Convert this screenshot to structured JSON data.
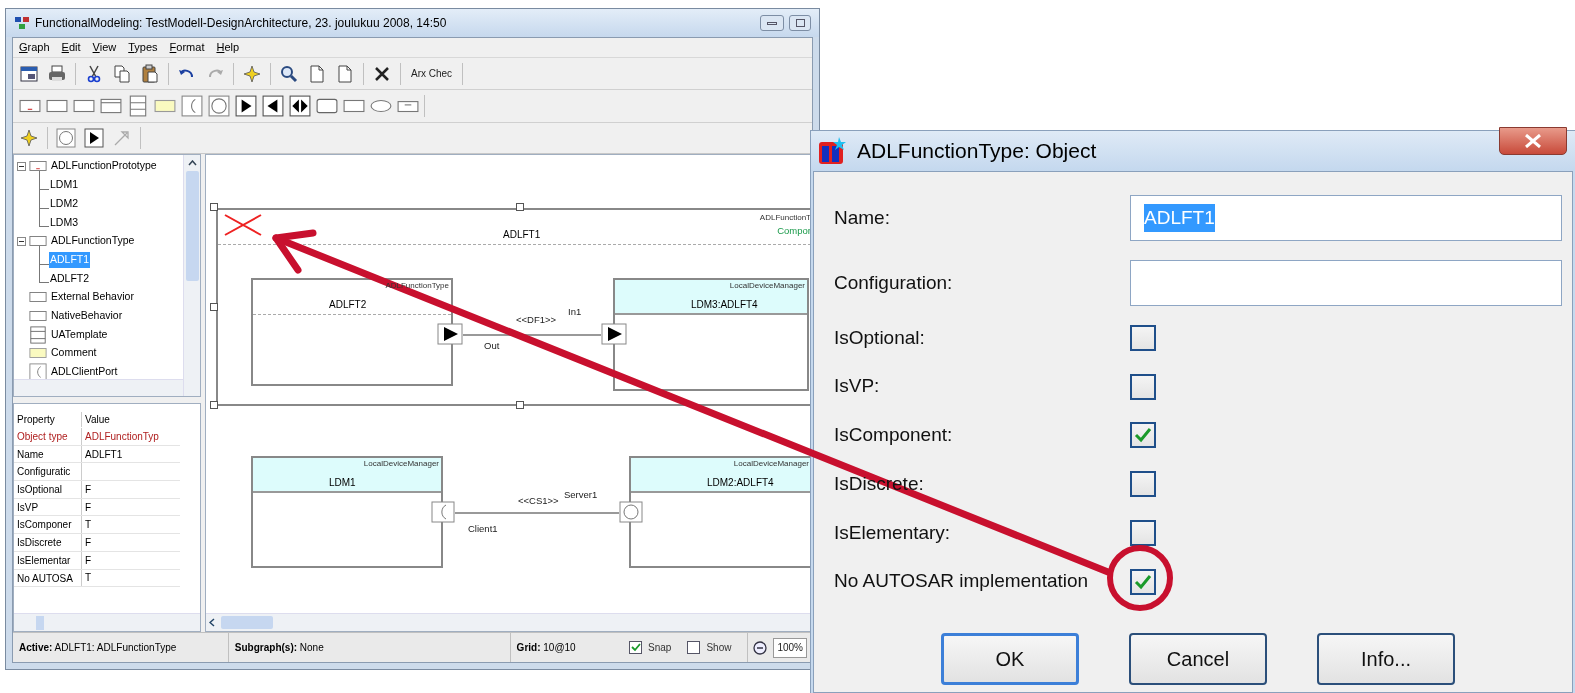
{
  "window": {
    "title": "FunctionalModeling: TestModell-DesignArchitecture, 23. joulukuu 2008, 14:50"
  },
  "menu": [
    "Graph",
    "Edit",
    "View",
    "Types",
    "Format",
    "Help"
  ],
  "toolbar": {
    "text_button": "Arx Chec"
  },
  "tree": [
    {
      "label": "ADLFunctionPrototype",
      "kind": "marked-box",
      "expanded": true,
      "selected": false,
      "children": [
        {
          "label": "LDM1",
          "selected": false
        },
        {
          "label": "LDM2",
          "selected": false
        },
        {
          "label": "LDM3",
          "selected": false
        }
      ]
    },
    {
      "label": "ADLFunctionType",
      "kind": "box",
      "expanded": true,
      "selected": false,
      "children": [
        {
          "label": "ADLFT1",
          "selected": true
        },
        {
          "label": "ADLFT2",
          "selected": false
        }
      ]
    },
    {
      "label": "External Behavior",
      "kind": "box",
      "selected": false
    },
    {
      "label": "NativeBehavior",
      "kind": "box",
      "selected": false
    },
    {
      "label": "UATemplate",
      "kind": "template",
      "selected": false
    },
    {
      "label": "Comment",
      "kind": "note",
      "selected": false
    },
    {
      "label": "ADLClientPort",
      "kind": "client-port",
      "selected": false
    }
  ],
  "properties": {
    "columns": [
      "Property",
      "Value"
    ],
    "rows": [
      {
        "property": "Object type",
        "value": "ADLFunctionTyp",
        "kind": "type"
      },
      {
        "property": "Name",
        "value": "ADLFT1",
        "kind": "plain"
      },
      {
        "property": "Configuratic",
        "kind": "plain"
      },
      {
        "property": "IsOptional",
        "value": "F",
        "kind": "plain"
      },
      {
        "property": "IsVP",
        "value": "F",
        "kind": "plain"
      },
      {
        "property": "IsComponer",
        "value": "T",
        "kind": "plain"
      },
      {
        "property": "IsDiscrete",
        "value": "F",
        "kind": "plain"
      },
      {
        "property": "IsElementar",
        "value": "F",
        "kind": "plain"
      },
      {
        "property": "No AUTOSA",
        "value": "T",
        "kind": "plain"
      }
    ]
  },
  "diagram": {
    "container": {
      "type_label": "ADLFunctionT",
      "stereotype": "Compor",
      "name": "ADLFT1"
    },
    "blocks": [
      {
        "type_label": "ADLFunctionType",
        "name": "ADLFT2",
        "kind": "type"
      },
      {
        "type_label": "LocalDeviceManager",
        "name": "LDM3:ADLFT4",
        "kind": "device"
      },
      {
        "type_label": "LocalDeviceManager",
        "name": "LDM1",
        "kind": "device"
      },
      {
        "type_label": "LocalDeviceManager",
        "name": "LDM2:ADLFT4",
        "kind": "device"
      }
    ],
    "connections": [
      {
        "label": "<<DF1>>",
        "source": "Out",
        "target": "In1",
        "kind": "data"
      },
      {
        "label": "<<CS1>>",
        "source": "Client1",
        "target": "Server1",
        "kind": "client-server"
      }
    ]
  },
  "status_bar": {
    "active": "**Active:** ADLFT1: ADLFunctionType",
    "subgraph": "**Subgraph(s):** None",
    "grid": "**Grid:** 10@10",
    "snap": {
      "label": "Snap",
      "checked": true
    },
    "show": {
      "label": "Show",
      "checked": false
    },
    "zoom": "100%"
  },
  "dialog": {
    "title": "ADLFunctionType: Object",
    "fields": [
      {
        "label": "Name:",
        "value": "ADLFT1",
        "highlighted": true
      },
      {
        "label": "Configuration:"
      }
    ],
    "checkboxes": [
      {
        "label": "IsOptional:",
        "checked": false
      },
      {
        "label": "IsVP:",
        "checked": false
      },
      {
        "label": "IsComponent:",
        "checked": true
      },
      {
        "label": "IsDiscrete:",
        "checked": false
      },
      {
        "label": "IsElementary:",
        "checked": false
      },
      {
        "label": "No AUTOSAR implementation",
        "checked": true
      }
    ],
    "buttons": [
      {
        "label": "OK",
        "default": true
      },
      {
        "label": "Cancel",
        "default": false
      },
      {
        "label": "Info...",
        "default": false
      }
    ]
  }
}
